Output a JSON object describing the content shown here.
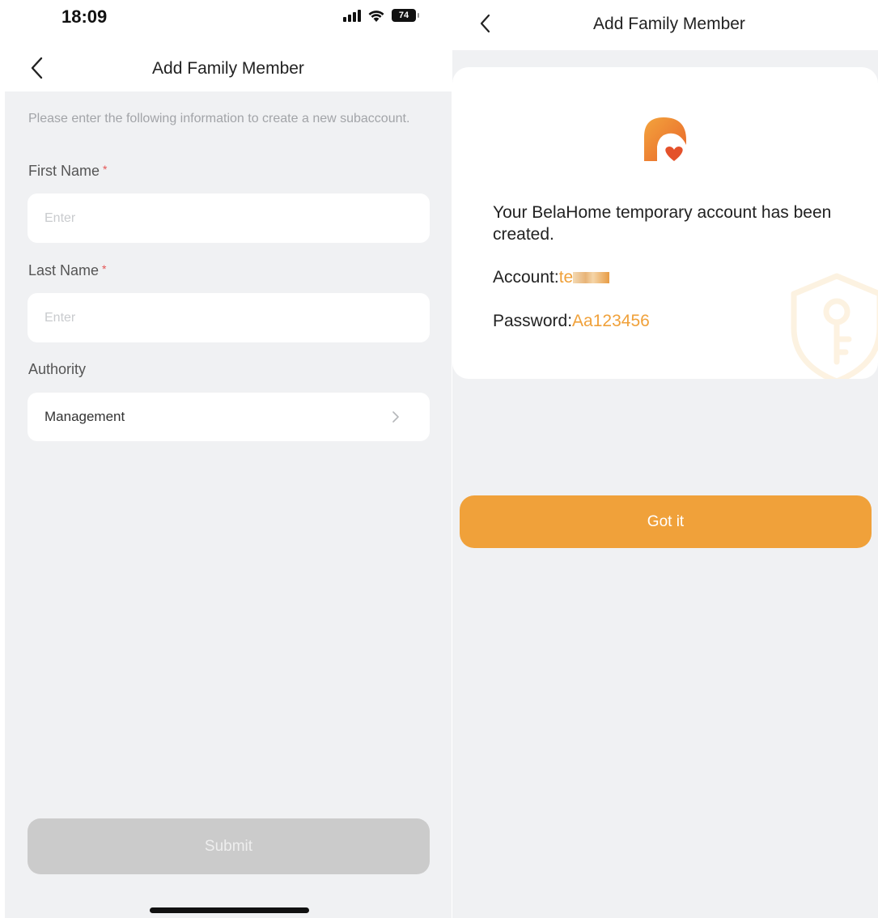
{
  "left_screen": {
    "status_bar": {
      "time": "18:09",
      "battery": "74"
    },
    "nav": {
      "title": "Add Family Member"
    },
    "intro_text": "Please enter the following information to create a new subaccount.",
    "first_name": {
      "label": "First Name",
      "required_mark": "*",
      "placeholder": "Enter",
      "value": ""
    },
    "last_name": {
      "label": "Last Name",
      "required_mark": "*",
      "placeholder": "Enter",
      "value": ""
    },
    "authority": {
      "label": "Authority",
      "selected": "Management"
    },
    "submit_label": "Submit"
  },
  "right_screen": {
    "nav": {
      "title": "Add Family Member"
    },
    "message": "Your BelaHome temporary account has been created.",
    "account": {
      "label": "Account:",
      "value_visible": "te"
    },
    "password": {
      "label": "Password:",
      "value": "Aa123456"
    },
    "got_it_label": "Got it"
  },
  "colors": {
    "accent": "#f0a13a",
    "required": "#e45555",
    "background": "#f0f1f3",
    "submit_disabled": "#cbcbcb"
  },
  "icons": [
    "back-chevron-icon",
    "signal-icon",
    "wifi-icon",
    "battery-icon",
    "chevron-right-icon",
    "belahome-logo-icon",
    "shield-key-icon"
  ]
}
